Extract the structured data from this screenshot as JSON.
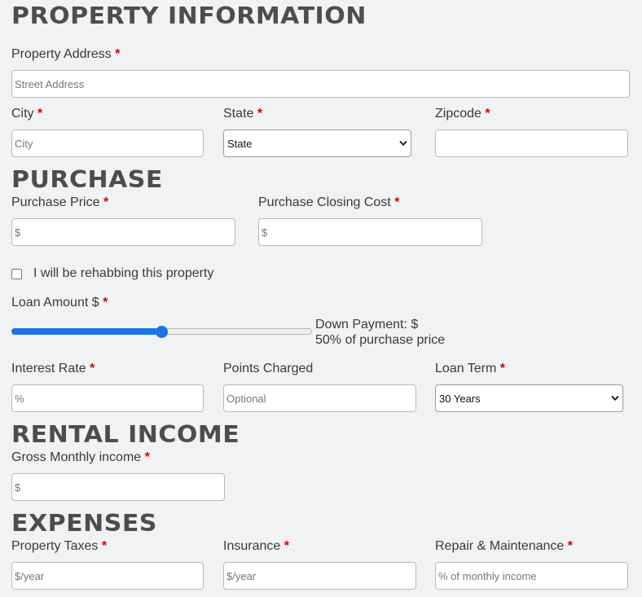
{
  "sections": {
    "property": "Property Information",
    "purchase": "Purchase",
    "rental": "Rental Income",
    "expenses": "Expenses"
  },
  "required_mark": "*",
  "property": {
    "address_label": "Property Address",
    "address_placeholder": "Street Address",
    "city_label": "City",
    "city_placeholder": "City",
    "state_label": "State",
    "state_value": "State",
    "zip_label": "Zipcode",
    "zip_placeholder": ""
  },
  "purchase": {
    "price_label": "Purchase Price",
    "price_placeholder": "$",
    "closing_label": "Purchase Closing Cost",
    "closing_placeholder": "$",
    "rehab_label": "I will be rehabbing this property",
    "rehab_checked": false,
    "loan_label": "Loan Amount $",
    "loan_slider_percent": 50,
    "down_payment_line1": "Down Payment: $",
    "down_payment_line2": "50% of purchase price",
    "interest_label": "Interest Rate",
    "interest_placeholder": "%",
    "points_label": "Points Charged",
    "points_placeholder": "Optional",
    "term_label": "Loan Term",
    "term_value": "30 Years"
  },
  "rental": {
    "gross_label": "Gross Monthly income",
    "gross_placeholder": "$"
  },
  "expenses": {
    "taxes_label": "Property Taxes",
    "taxes_placeholder": "$/year",
    "insurance_label": "Insurance",
    "insurance_placeholder": "$/year",
    "repair_label": "Repair & Maintenance",
    "repair_placeholder": "% of monthly income"
  },
  "colors": {
    "accent": "#1a73e8",
    "required": "#d40000",
    "heading": "#4d4d4d",
    "background": "#f1f2f4"
  }
}
